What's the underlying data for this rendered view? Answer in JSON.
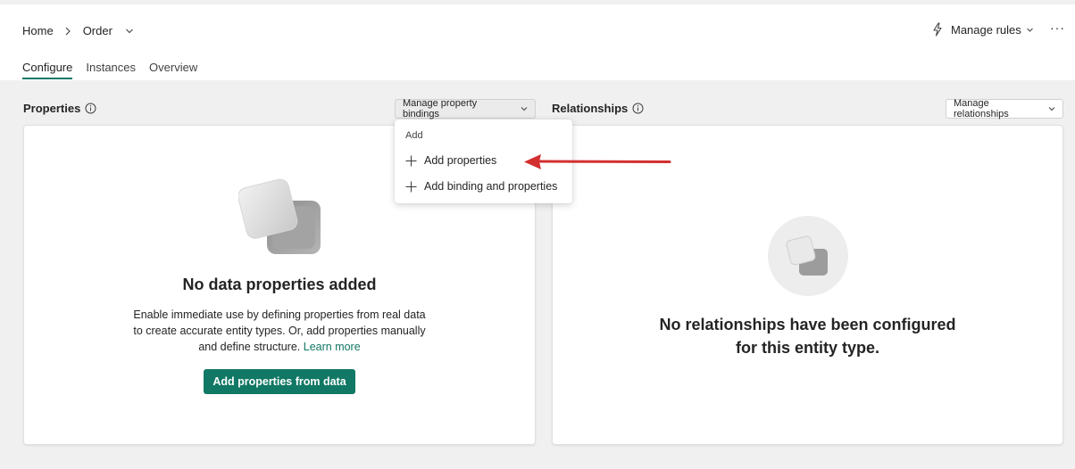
{
  "header": {
    "breadcrumb": {
      "home": "Home",
      "current": "Order"
    },
    "tabs": [
      {
        "label": "Configure",
        "active": true
      },
      {
        "label": "Instances",
        "active": false
      },
      {
        "label": "Overview",
        "active": false
      }
    ],
    "manage_rules": "Manage rules",
    "more": "···"
  },
  "properties": {
    "title": "Properties",
    "manage_button": "Manage property bindings",
    "empty_title": "No data properties added",
    "empty_desc_lines": [
      "Enable immediate use by defining properties from real data",
      "to create accurate entity types. Or, add properties manually",
      "and define structure."
    ],
    "learn_more": "Learn more",
    "primary_button": "Add properties from data"
  },
  "menu": {
    "header": "Add",
    "items": [
      "Add properties",
      "Add binding and properties"
    ]
  },
  "relationships": {
    "title": "Relationships",
    "manage_button": "Manage relationships",
    "empty_title_lines": [
      "No relationships have been configured",
      "for this entity type."
    ]
  },
  "colors": {
    "accent": "#117865",
    "arrow": "#d32f2f"
  },
  "icons": [
    "chevron-right-icon",
    "chevron-down-icon",
    "flash-icon",
    "info-icon",
    "plus-icon",
    "empty-shapes-icon",
    "arrow-annotation-icon"
  ]
}
